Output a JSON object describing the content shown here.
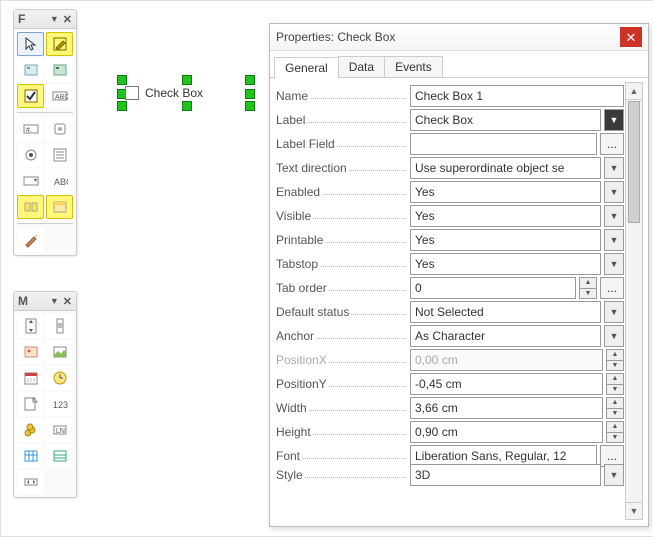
{
  "toolbox_f": {
    "letter": "F"
  },
  "toolbox_m": {
    "letter": "M"
  },
  "canvas": {
    "checkbox_label": "Check Box"
  },
  "dialog": {
    "title": "Properties: Check Box",
    "tabs": [
      "General",
      "Data",
      "Events"
    ],
    "rows": [
      {
        "label": "Name",
        "value": "Check Box 1",
        "kind": "text"
      },
      {
        "label": "Label",
        "value": "Check Box",
        "kind": "bigdd"
      },
      {
        "label": "Label Field",
        "value": "",
        "kind": "dots-only"
      },
      {
        "label": "Text direction",
        "value": "Use superordinate object se",
        "kind": "dd"
      },
      {
        "label": "Enabled",
        "value": "Yes",
        "kind": "dd"
      },
      {
        "label": "Visible",
        "value": "Yes",
        "kind": "dd"
      },
      {
        "label": "Printable",
        "value": "Yes",
        "kind": "dd"
      },
      {
        "label": "Tabstop",
        "value": "Yes",
        "kind": "dd"
      },
      {
        "label": "Tab order",
        "value": "0",
        "kind": "spin-dots"
      },
      {
        "label": "Default status",
        "value": "Not Selected",
        "kind": "dd"
      },
      {
        "label": "Anchor",
        "value": "As Character",
        "kind": "dd"
      },
      {
        "label": "PositionX",
        "value": "0,00 cm",
        "kind": "spin",
        "disabled": true
      },
      {
        "label": "PositionY",
        "value": "-0,45 cm",
        "kind": "spin"
      },
      {
        "label": "Width",
        "value": "3,66 cm",
        "kind": "spin"
      },
      {
        "label": "Height",
        "value": "0,90 cm",
        "kind": "spin"
      },
      {
        "label": "Font",
        "value": "Liberation Sans, Regular, 12",
        "kind": "text-dots"
      },
      {
        "label": "Style",
        "value": "3D",
        "kind": "dd",
        "cut": true
      }
    ]
  }
}
